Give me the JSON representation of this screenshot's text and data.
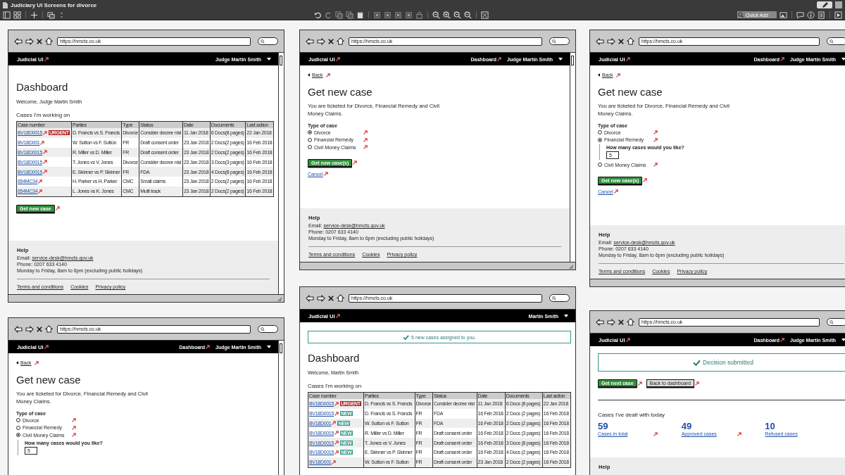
{
  "app": {
    "title": "Judiciary UI Screens for divorce",
    "quick_add": {
      "placeholder": "Quick Add"
    }
  },
  "mockups": [
    {
      "kind": "dashboard",
      "url": "https://hmcts.co.uk",
      "brand": "Judicial UI",
      "user": "Judge Martin Smith",
      "has_scrollbar": true,
      "heading": "Dashboard",
      "welcome": "Welcome, Judge Martin Smith",
      "section": "Cases I'm working on",
      "columns": [
        "Case number",
        "Parties",
        "Type",
        "Status",
        "Date",
        "Documents",
        "Last action"
      ],
      "rows": [
        {
          "tag": {
            "text": "URGENT",
            "kind": "urgent"
          },
          "cells": [
            "BV18D0015",
            "D. Francis vs S. Francis",
            "Divorce",
            "Consider decree nisi",
            "11 Jan 2018",
            "6 Docs(8 pages)",
            "22 Jan 2018"
          ]
        },
        {
          "cells": [
            "BV18D001",
            "W. Sutton vs F. Sutton",
            "FR",
            "Draft consent order",
            "23 Jan 2018",
            "2 Docs(2 pages)",
            "16 Feb 2018"
          ]
        },
        {
          "cells": [
            "BV18D0015",
            "R. Miller vs D. Miller",
            "FR",
            "Draft consent order",
            "23 Jan 2018",
            "2 Docs(2 pages)",
            "16 Feb 2018"
          ]
        },
        {
          "cells": [
            "BV18D0015",
            "T. Jones vs V. Jones",
            "Divorce",
            "Consider decree nisi",
            "23 Jan 2018",
            "3 Docs(3 pages)",
            "16 Feb 2018"
          ]
        },
        {
          "cells": [
            "BV18D0015",
            "E. Skinner vs P. Skinner",
            "FR",
            "FDA",
            "23 Jan 2018",
            "4 Docs(8 pages)",
            "16 Feb 2018"
          ]
        },
        {
          "cells": [
            "654MC34",
            "H. Parker vs H. Parker",
            "CMC",
            "Small claims",
            "23 Jan 2018",
            "2 Docs(2 pages)",
            "16 Feb 2018"
          ]
        },
        {
          "cells": [
            "654MC34",
            "L. Jones vs K. Jones",
            "CMC",
            "Multi track",
            "23 Jan 2018",
            "2 Docs(2 pages)",
            "16 Feb 2018"
          ]
        }
      ],
      "button": "Get new case",
      "footer": {
        "heading": "Help",
        "email_label": "Email:",
        "email": "service-desk@hmcts.gov.uk",
        "phone": "Phone: 0207 633 4140",
        "hours": "Monday to Friday, 8am to 6pm (excluding public holidays)",
        "links": [
          "Terms and conditions",
          "Cookies",
          "Privacy policy"
        ]
      }
    },
    {
      "kind": "get_case",
      "url": "https://hmcts.co.uk",
      "brand": "Judicial UI",
      "nav_link": "Dashboard",
      "user": "Judge Martin Smith",
      "has_scrollbar": true,
      "back": "Back",
      "heading": "Get new case",
      "intro": "You are ticketed for Divorce, Financial Remedy and Civil Money Claims.",
      "legend": "Type of case",
      "options": [
        {
          "label": "Divorce",
          "selected": true
        },
        {
          "label": "Financial Remedy",
          "selected": false
        },
        {
          "label": "Civil Money Claims",
          "selected": false
        }
      ],
      "button": "Get new case(s)",
      "cancel": "Cancel",
      "footer": {
        "heading": "Help",
        "email_label": "Email:",
        "email": "service-desk@hmcts.gov.uk",
        "phone": "Phone: 0207 633 4140",
        "hours": "Monday to Friday, 8am to 6pm (excluding public holidays)",
        "links": [
          "Terms and conditions",
          "Cookies",
          "Privacy policy"
        ]
      }
    },
    {
      "kind": "get_case",
      "url": "https://hmcts.co.uk",
      "brand": "Judicial UI",
      "nav_link": "Dashboard",
      "user": "Judge Martin Smith",
      "back": "Back",
      "heading": "Get new case",
      "intro": "You are ticketed for Divorce, Financial Remedy and Civil Money Claims.",
      "legend": "Type of case",
      "options": [
        {
          "label": "Divorce",
          "selected": false
        },
        {
          "label": "Financial Remedy",
          "selected": true,
          "question": "How many cases would you like?",
          "value": "5"
        },
        {
          "label": "Civil Money Claims",
          "selected": false
        }
      ],
      "button": "Get new case(s)",
      "cancel": "Cancel",
      "footer": {
        "heading": "Help",
        "email_label": "Email:",
        "email": "service-desk@hmcts.gov.uk",
        "phone": "Phone: 0207 633 4140",
        "hours": "Monday to Friday, 8am to 6pm (excluding public holidays)",
        "links": [
          "Terms and conditions",
          "Cookies",
          "Privacy policy"
        ]
      }
    },
    {
      "kind": "get_case",
      "url": "https://hmcts.co.uk",
      "brand": "Judicial UI",
      "nav_link": "Dashboard",
      "user": "Judge Martin Smith",
      "has_scrollbar": true,
      "back": "Back",
      "heading": "Get new case",
      "intro": "You are ticketed for Divorce, Financial Remedy and Civil Money Claims.",
      "legend": "Type of case",
      "options": [
        {
          "label": "Divorce",
          "selected": false
        },
        {
          "label": "Financial Remedy",
          "selected": false
        },
        {
          "label": "Civil Money Claims",
          "selected": true,
          "question": "How many cases would you like?",
          "value": "5"
        }
      ]
    },
    {
      "kind": "dashboard",
      "url": "https://hmcts.co.uk",
      "brand": "Judicial UI",
      "user": "Martin Smith",
      "notice": "5 new cases assigned to you.",
      "heading": "Dashboard",
      "welcome": "Welcome, Martin Smith",
      "section": "Cases I'm working on",
      "columns": [
        "Case number",
        "Parties",
        "Type",
        "Status",
        "Date",
        "Documents",
        "Last action"
      ],
      "rows": [
        {
          "tag": {
            "text": "URGENT",
            "kind": "urgent"
          },
          "cells": [
            "BV18D0015",
            "D. Francis vs S. Francis",
            "Divorce",
            "Consider decree nisi",
            "11 Jan 2018",
            "6 Docs (8 pages)",
            "22 Jan 2018"
          ]
        },
        {
          "tag": {
            "text": "NEW",
            "kind": "new"
          },
          "cells": [
            "BV18D0015",
            "D. Francis vs S. Francis",
            "FR",
            "FDA",
            "16 Feb 2018",
            "2 Docs (2 pages)",
            "16 Feb 2018"
          ]
        },
        {
          "tag": {
            "text": "NEW",
            "kind": "new"
          },
          "cells": [
            "BV18D001",
            "W. Sutton vs F. Sutton",
            "FR",
            "FDA",
            "16 Feb 2018",
            "2 Docs (2 pages)",
            "16 Feb 2018"
          ]
        },
        {
          "tag": {
            "text": "NEW",
            "kind": "new"
          },
          "cells": [
            "BV18D0015",
            "R. Miller vs D. Miller",
            "FR",
            "Draft consent order",
            "16 Feb 2018",
            "2 Docs (3 pages)",
            "16 Feb 2018"
          ]
        },
        {
          "tag": {
            "text": "NEW",
            "kind": "new"
          },
          "cells": [
            "BV18D0015",
            "T. Jones vs V. Jones",
            "FR",
            "Draft consent order",
            "16 Feb 2018",
            "3 Docs (8 pages)",
            "16 Feb 2018"
          ]
        },
        {
          "tag": {
            "text": "NEW",
            "kind": "new"
          },
          "cells": [
            "BV18D0015",
            "E. Skinner vs P. Skinner",
            "FR",
            "Draft consent order",
            "16 Feb 2018",
            "4 Docs (2 pages)",
            "16 Feb 2018"
          ]
        },
        {
          "cells": [
            "BV18D001",
            "W. Sutton vs F. Sutton",
            "FR",
            "Draft consent order",
            "23 Jan 2018",
            "2 Docs (2 pages)",
            "16 Feb 2018"
          ]
        }
      ]
    },
    {
      "kind": "decision",
      "url": "https://hmcts.co.uk",
      "brand": "Judicial UI",
      "nav_link": "Dashboard",
      "user": "Judge Martin Smith",
      "banner": "Decision submitted",
      "primary": "Get next case",
      "secondary": "Back to dashboard",
      "section": "Cases I've dealt with today",
      "stats": [
        {
          "value": "59",
          "label": "Cases in total",
          "linked": true
        },
        {
          "value": "49",
          "label": "Approved cases",
          "linked": true
        },
        {
          "value": "10",
          "label": "Refused cases"
        }
      ],
      "footer": {
        "heading": "Help"
      }
    }
  ]
}
